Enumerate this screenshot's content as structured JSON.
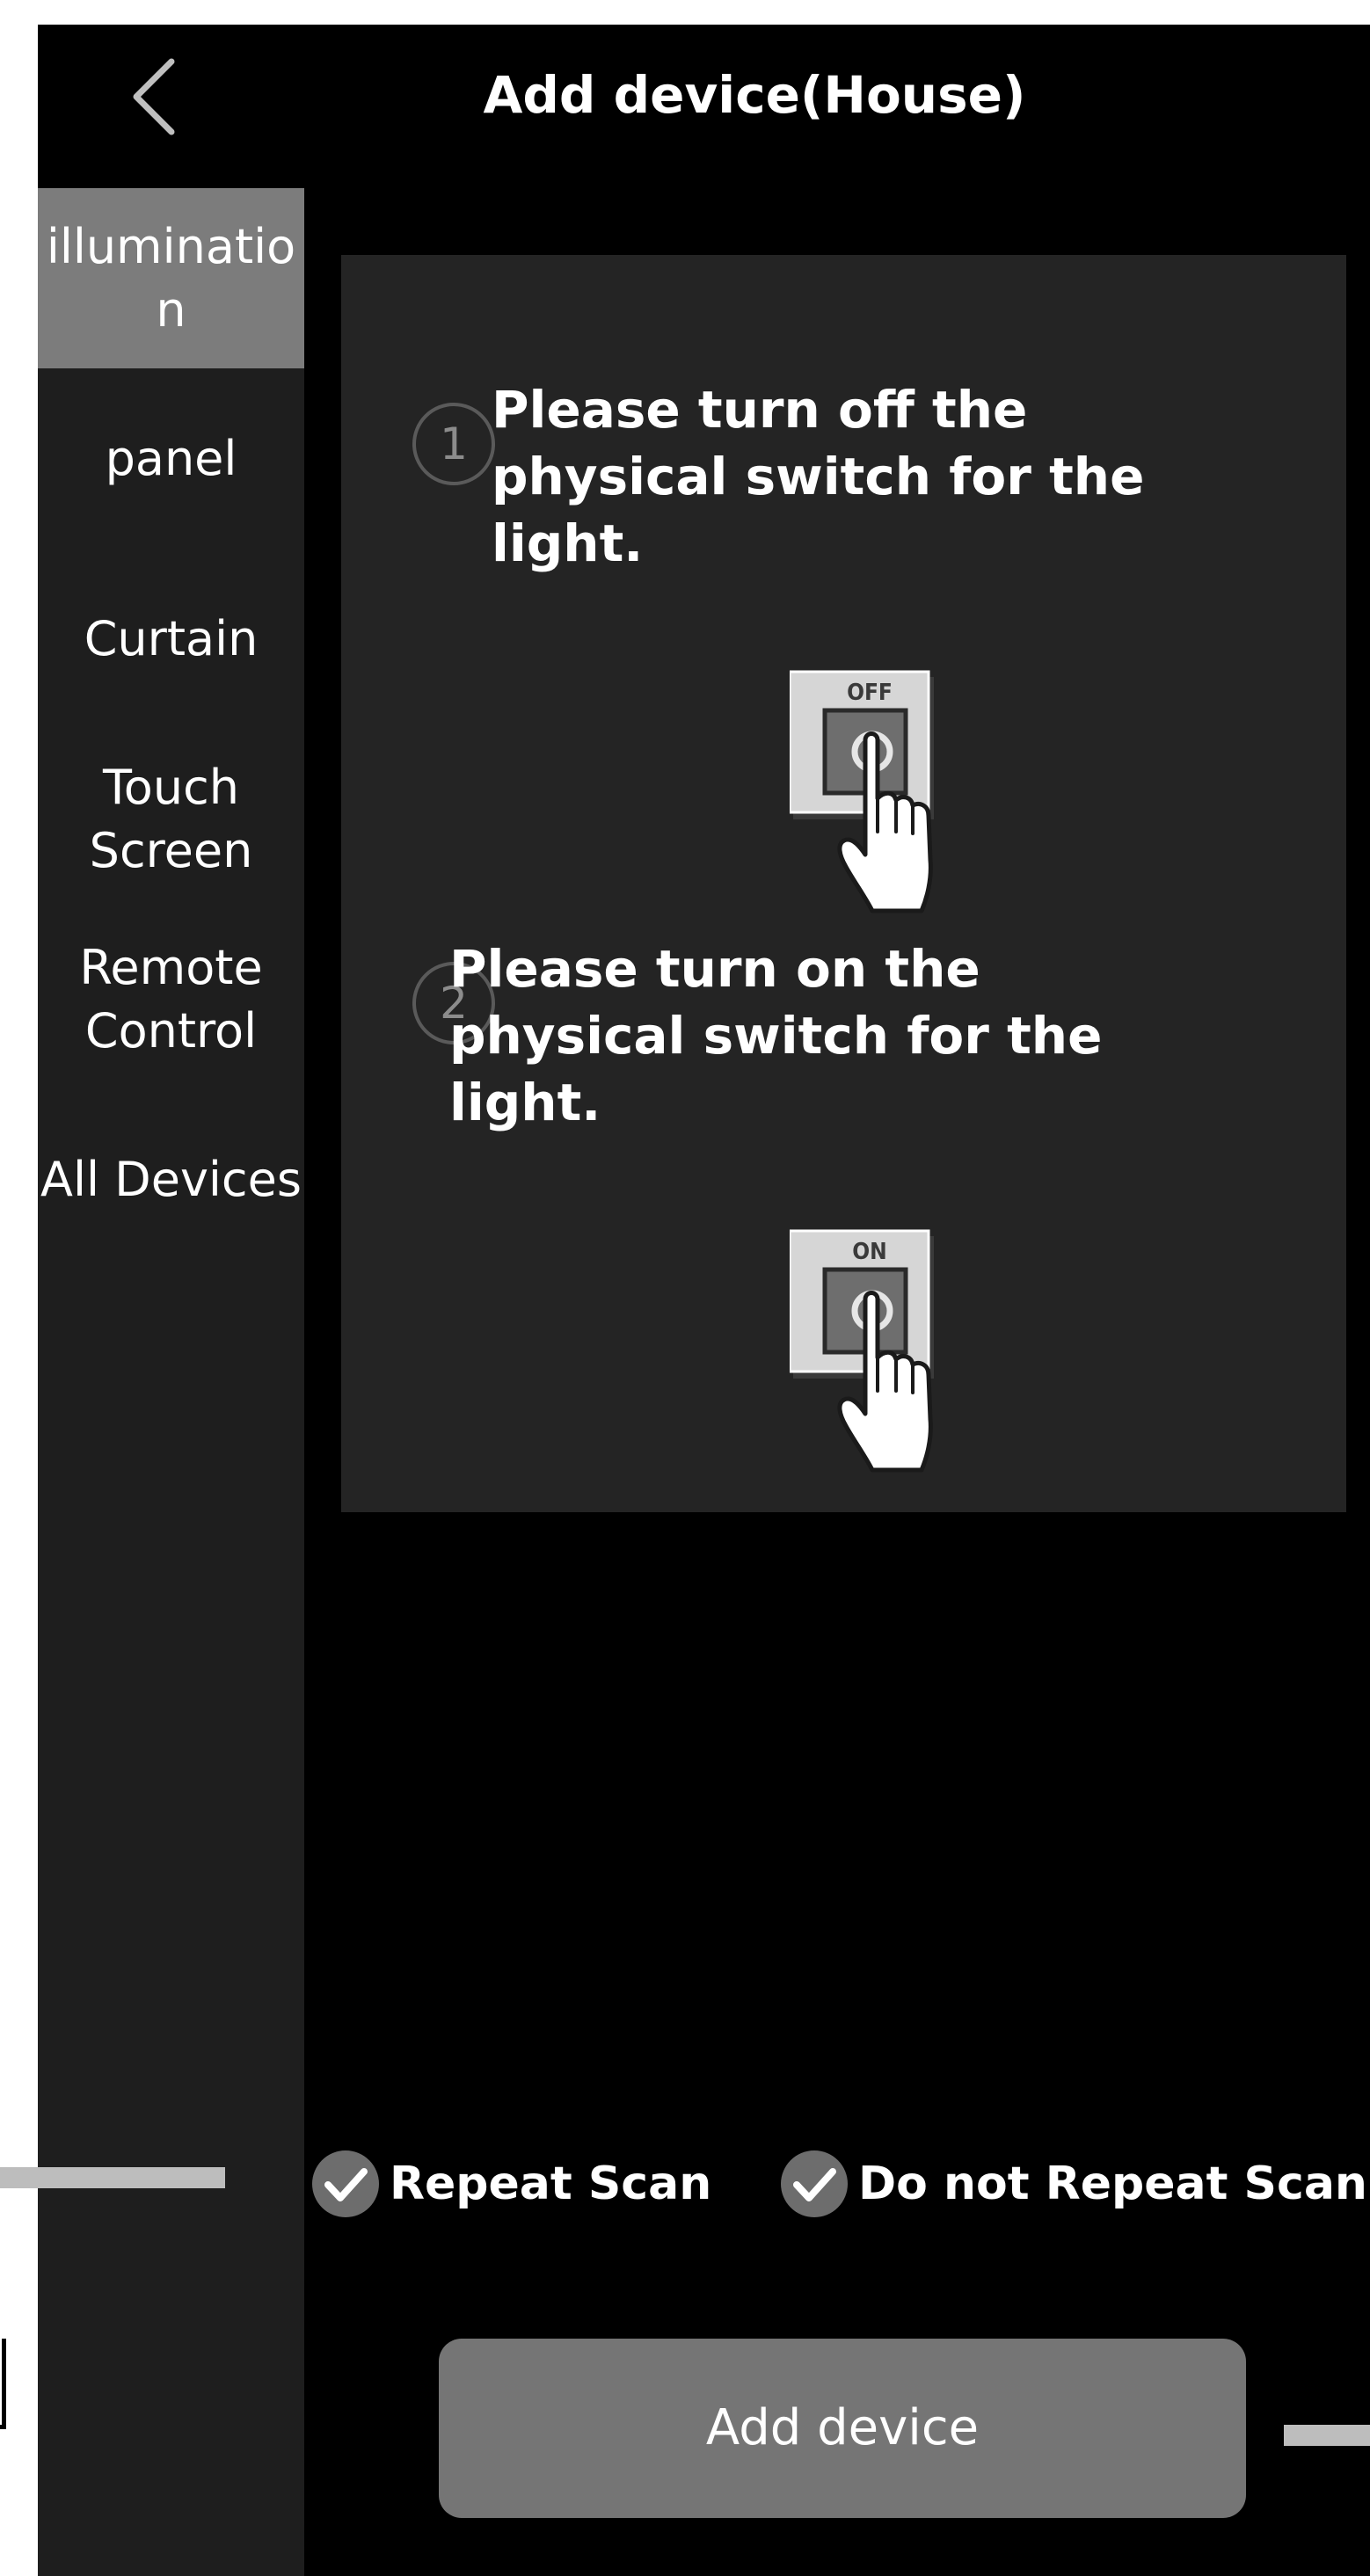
{
  "header": {
    "title": "Add device(House)",
    "back_icon": "chevron-left-icon"
  },
  "sidebar": {
    "active_index": 0,
    "items": [
      {
        "label_lines": [
          "illuminatio",
          "n"
        ]
      },
      {
        "label_lines": [
          "panel"
        ]
      },
      {
        "label_lines": [
          "Curtain"
        ]
      },
      {
        "label_lines": [
          "Touch",
          "Screen"
        ]
      },
      {
        "label_lines": [
          "Remote",
          "Control"
        ]
      },
      {
        "label_lines": [
          "All Devices"
        ]
      }
    ]
  },
  "instructions": {
    "steps": [
      {
        "number": "1",
        "text_lines": [
          "Please turn off the",
          "physical switch for the",
          "light."
        ],
        "switch_label": "OFF",
        "icon": "switch-off-hand-icon"
      },
      {
        "number": "2",
        "text_lines": [
          "Please turn on the",
          "physical switch for the",
          "light."
        ],
        "switch_label": "ON",
        "icon": "switch-on-hand-icon"
      }
    ]
  },
  "scan_options": [
    {
      "label": "Repeat Scan",
      "checked": true,
      "icon": "check-circle-icon"
    },
    {
      "label": "Do not Repeat Scan",
      "checked": true,
      "icon": "check-circle-icon"
    }
  ],
  "add_button": {
    "label": "Add device"
  },
  "colors": {
    "background": "#000000",
    "sidebar": "#1e1e1e",
    "sidebar_active": "#7c7c7c",
    "card": "#242424",
    "button": "#757575",
    "check": "#6d6d6d",
    "text": "#ffffff"
  }
}
